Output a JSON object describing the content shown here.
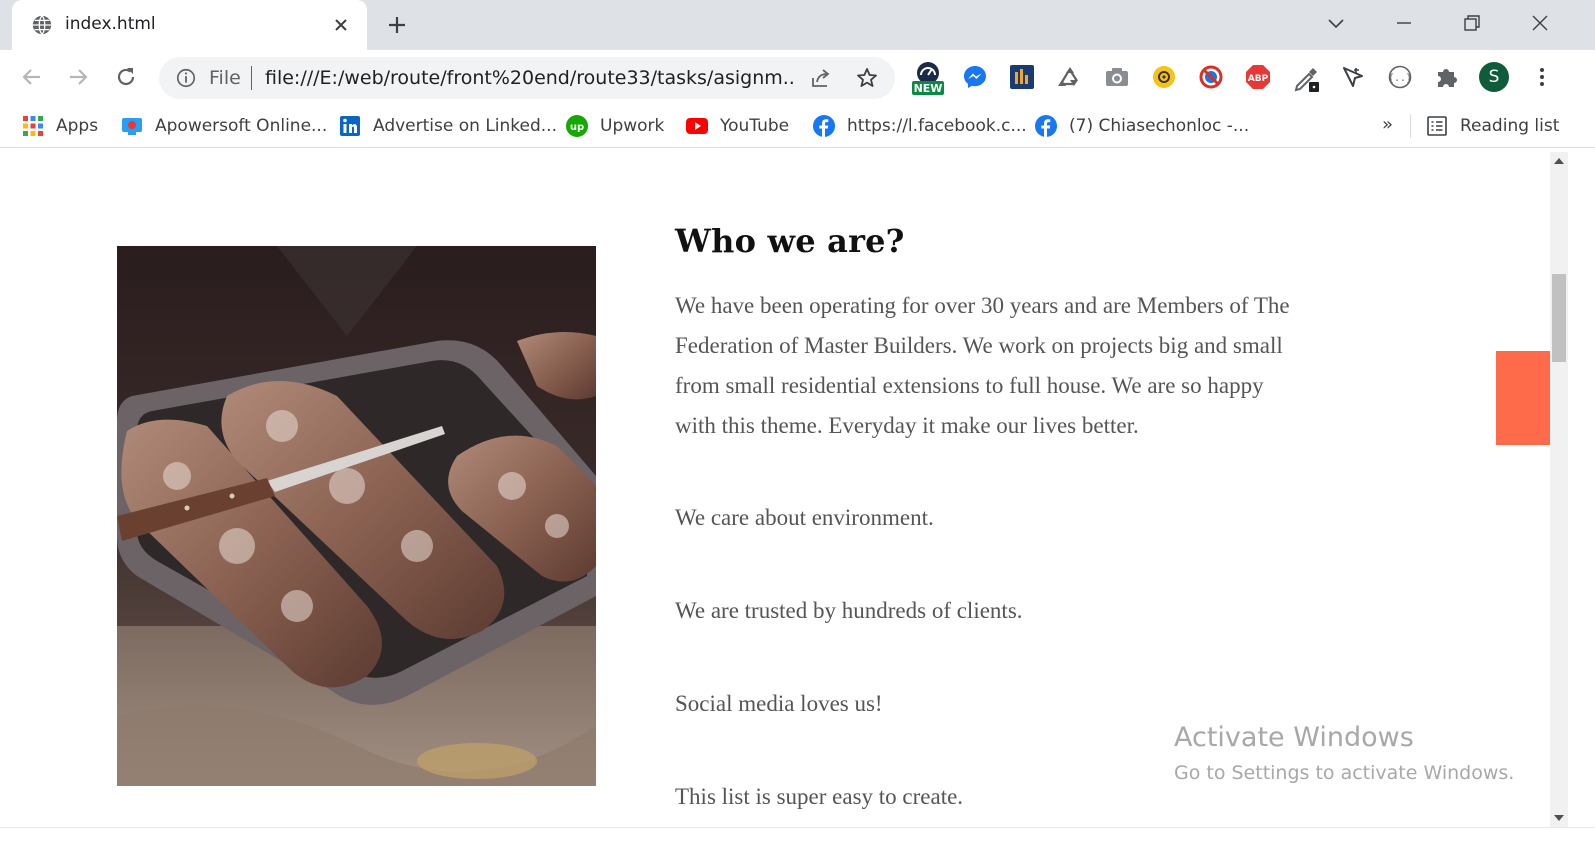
{
  "browser": {
    "tab": {
      "title": "index.html",
      "favicon": "globe-icon"
    },
    "new_tab_icon": "plus-icon",
    "window_controls": [
      "tab-search-icon",
      "minimize-icon",
      "restore-icon",
      "close-icon"
    ],
    "toolbar": {
      "back_icon": "arrow-left-icon",
      "forward_icon": "arrow-right-icon",
      "reload_icon": "reload-icon",
      "scheme_label": "File",
      "url": "file:///E:/web/route/front%20end/route33/tasks/asignm...",
      "extensions": [
        {
          "name": "new-extension-icon",
          "badge": "NEW"
        },
        {
          "name": "messenger-icon"
        },
        {
          "name": "analytics-icon"
        },
        {
          "name": "recycle-icon"
        },
        {
          "name": "camera-icon"
        },
        {
          "name": "emoji-icon"
        },
        {
          "name": "block-icon"
        },
        {
          "name": "adblock-icon",
          "badge": "ABP"
        },
        {
          "name": "eyedropper-icon"
        },
        {
          "name": "cursor-icon"
        },
        {
          "name": "json-icon"
        },
        {
          "name": "puzzle-icon"
        }
      ],
      "profile_initial": "S"
    },
    "bookmarks": [
      {
        "label": "Apps",
        "icon": "apps-grid-icon"
      },
      {
        "label": "Apowersoft Online...",
        "icon": "apowersoft-icon"
      },
      {
        "label": "Advertise on Linked...",
        "icon": "linkedin-icon"
      },
      {
        "label": "Upwork",
        "icon": "upwork-icon"
      },
      {
        "label": "YouTube",
        "icon": "youtube-icon"
      },
      {
        "label": "https://l.facebook.c...",
        "icon": "facebook-icon"
      },
      {
        "label": "(7) Chiasechonloc -...",
        "icon": "facebook-icon"
      }
    ],
    "bookmarks_overflow": "»",
    "reading_list": "Reading list"
  },
  "page": {
    "image_subject": "bread-loaves-in-tray",
    "heading": "Who we are?",
    "intro": "We have been operating for over 30 years and are Members of The Federation of Master Builders. We work on projects big and small from small residential extensions to full house. We are so happy with this theme. Everyday it make our lives better.",
    "points": [
      "We care about environment.",
      "We are trusted by hundreds of clients.",
      "Social media loves us!",
      "This list is super easy to create."
    ],
    "accent_color": "#fd6b4b"
  },
  "watermark": {
    "title": "Activate Windows",
    "subtitle": "Go to Settings to activate Windows."
  }
}
